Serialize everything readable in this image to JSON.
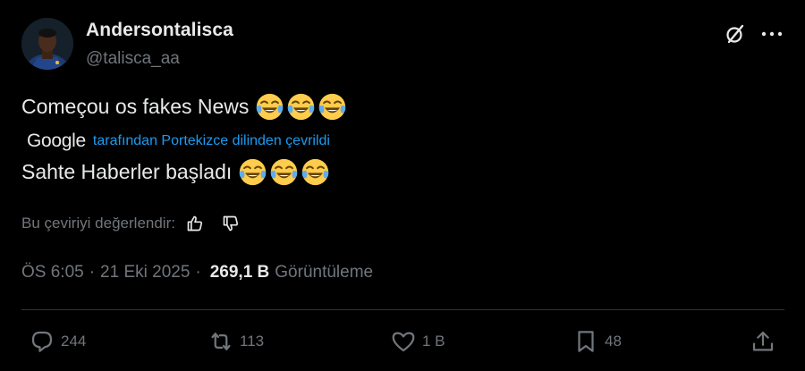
{
  "author": {
    "display_name": "Andersontalisca",
    "handle": "@talisca_aa",
    "avatar": "profile-photo"
  },
  "header_icons": {
    "grok": "grok-slash-icon",
    "more": "more-dots-icon"
  },
  "tweet": {
    "text": "Começou os fakes News",
    "emoji": [
      "face-with-tears-of-joy",
      "face-with-tears-of-joy",
      "face-with-tears-of-joy"
    ]
  },
  "translation": {
    "provider": "Google",
    "attribution": "tarafından Portekizce dilinden çevrildi",
    "text": "Sahte Haberler başladı",
    "emoji": [
      "face-with-tears-of-joy",
      "face-with-tears-of-joy",
      "face-with-tears-of-joy"
    ],
    "rate_label": "Bu çeviriyi değerlendir:"
  },
  "meta": {
    "time": "ÖS 6:05",
    "separator": "·",
    "date": "21 Eki 2025",
    "views_count": "269,1 B",
    "views_label": "Görüntüleme"
  },
  "actions": {
    "reply_count": "244",
    "retweet_count": "113",
    "like_count": "1 B",
    "bookmark_count": "48"
  },
  "colors": {
    "background": "#000000",
    "text": "#e7e9ea",
    "muted": "#71767b",
    "link": "#1d9bf0",
    "divider": "#2f3336",
    "emoji_face": "#ffcc4d"
  }
}
